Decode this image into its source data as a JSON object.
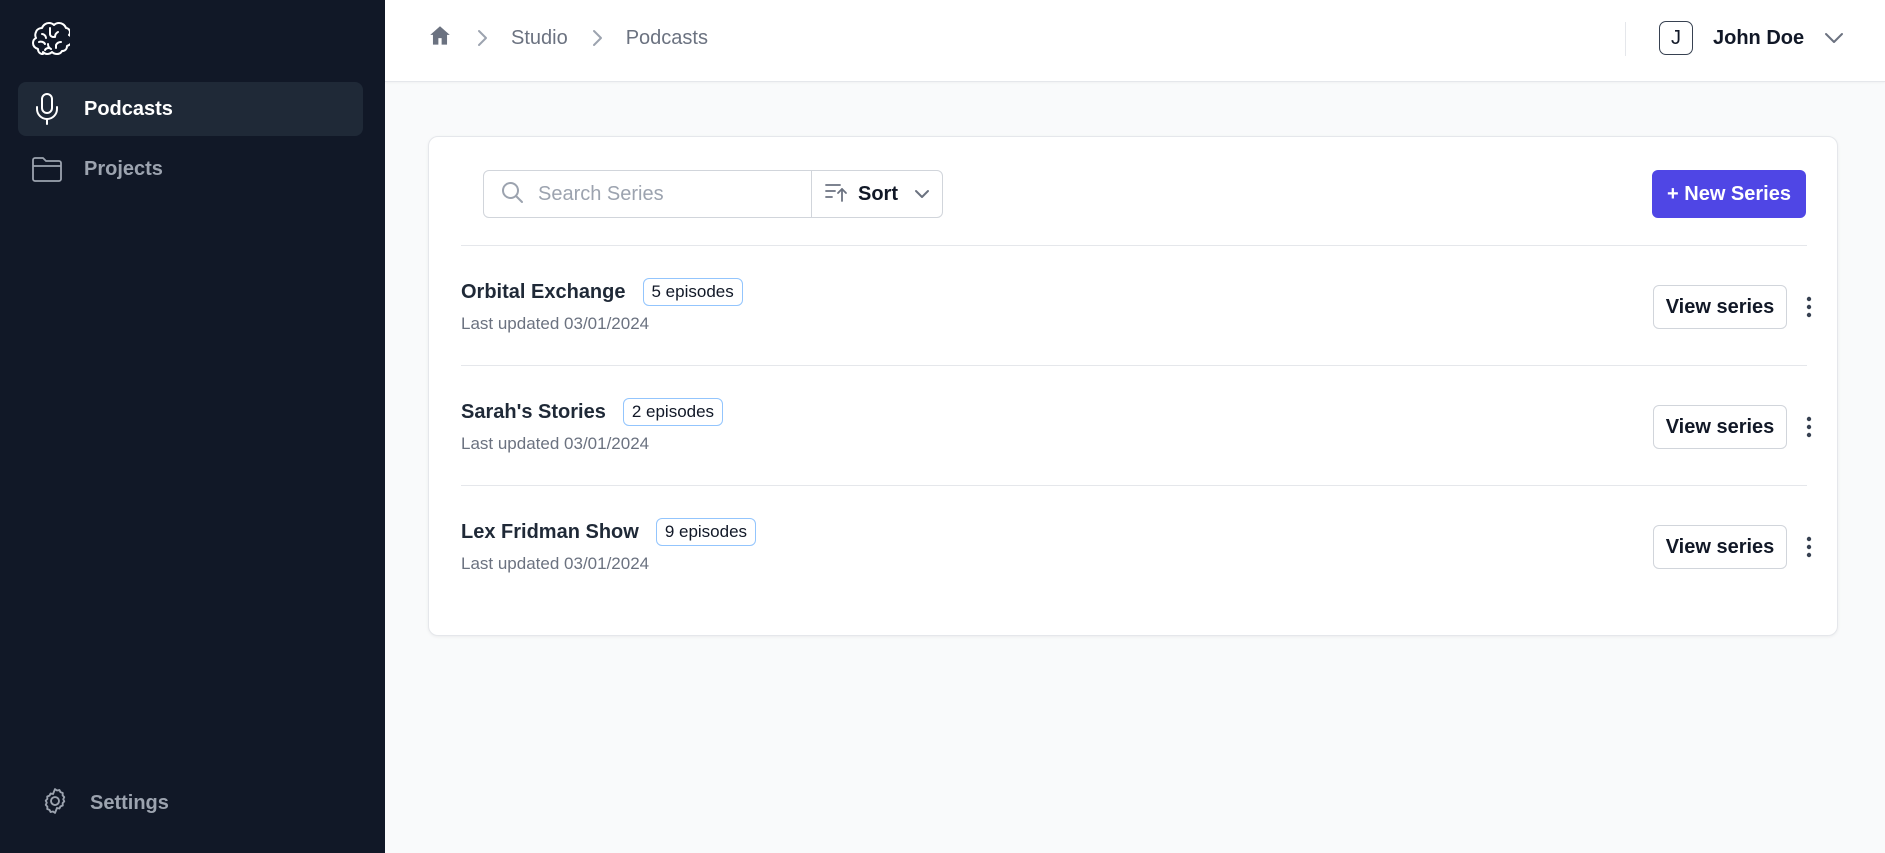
{
  "sidebar": {
    "items": [
      {
        "label": "Podcasts",
        "icon": "microphone-icon",
        "active": true
      },
      {
        "label": "Projects",
        "icon": "folder-icon",
        "active": false
      }
    ],
    "settings_label": "Settings"
  },
  "header": {
    "breadcrumb": [
      "Studio",
      "Podcasts"
    ],
    "user": {
      "initial": "J",
      "name": "John Doe"
    }
  },
  "toolbar": {
    "search_placeholder": "Search Series",
    "sort_label": "Sort",
    "new_series_label": "+ New Series"
  },
  "series": [
    {
      "name": "Orbital Exchange",
      "episodes": "5 episodes",
      "updated": "Last updated 03/01/2024",
      "action": "View series"
    },
    {
      "name": "Sarah's Stories",
      "episodes": "2 episodes",
      "updated": "Last updated 03/01/2024",
      "action": "View series"
    },
    {
      "name": "Lex Fridman Show",
      "episodes": "9 episodes",
      "updated": "Last updated 03/01/2024",
      "action": "View series"
    }
  ],
  "colors": {
    "sidebar_bg": "#111827",
    "active_item_bg": "#1f2937",
    "primary": "#4f46e5",
    "badge_border": "#93c5fd"
  }
}
